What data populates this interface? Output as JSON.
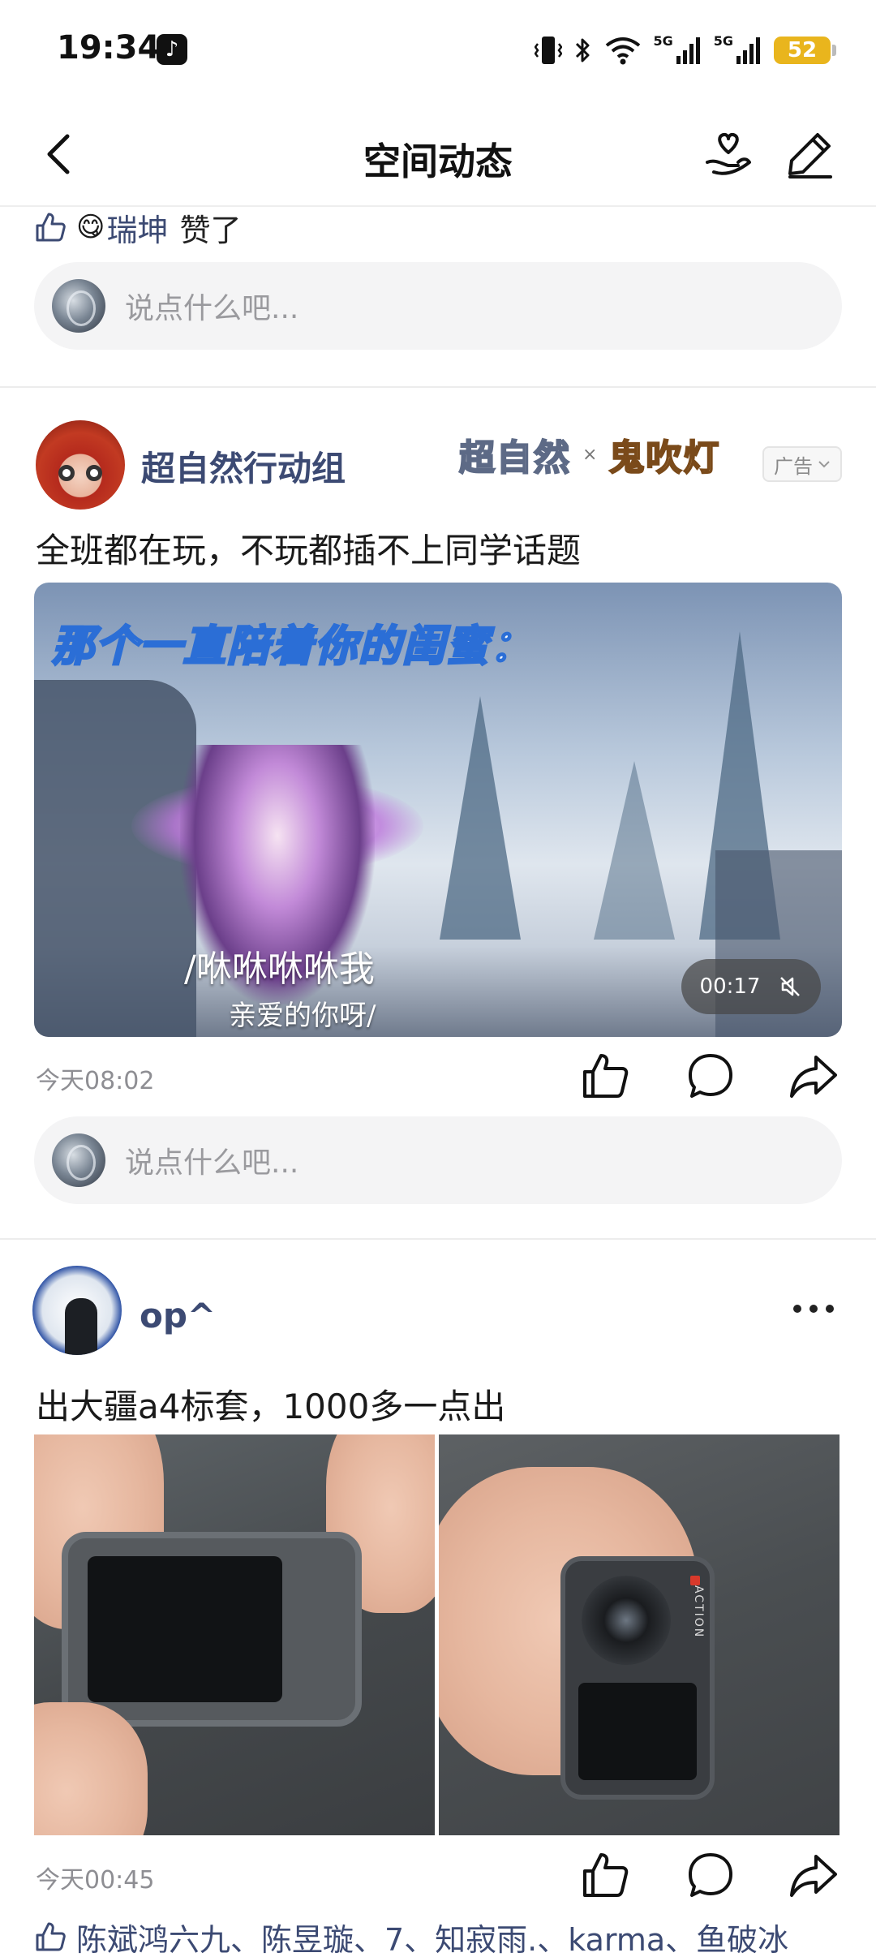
{
  "status_bar": {
    "time": "19:34",
    "battery": "52",
    "net1": "5G",
    "net2": "5G",
    "icons": [
      "tiktok-icon",
      "vibrate-icon",
      "bluetooth-icon",
      "wifi-icon",
      "signal-icon",
      "signal-icon",
      "battery-icon"
    ]
  },
  "nav": {
    "title": "空间动态",
    "icons": [
      "back-icon",
      "heart-hand-icon",
      "edit-icon"
    ]
  },
  "prev_post": {
    "liker_emoji": "😋",
    "liker": "瑞坤",
    "liked_suffix": "赞了",
    "comment_placeholder": "说点什么吧..."
  },
  "ad_post": {
    "author": "超自然行动组",
    "logo_left": "超自然",
    "logo_x": "×",
    "logo_right": "鬼吹灯",
    "ad_badge": "广告",
    "text": "全班都在玩，不玩都插不上同学话题",
    "video": {
      "caption_top": "那个一直陪着你的闺蜜：",
      "caption_line1": "/咻咻咻咻我",
      "caption_line2": "亲爱的你呀/",
      "duration": "00:17",
      "muted": true
    },
    "time": "今天08:02",
    "comment_placeholder": "说点什么吧..."
  },
  "op_post": {
    "author": "op^",
    "text": "出大疆a4标套，1000多一点出",
    "camera_label": "ACTION",
    "time": "今天00:45",
    "likers": "陈斌鸿六九、陈昱璇、7、知寂雨.、karma、鱼破冰"
  },
  "colors": {
    "name_blue": "#3c4a73",
    "battery": "#e9b51d",
    "muted_gray": "#8e8e93"
  }
}
